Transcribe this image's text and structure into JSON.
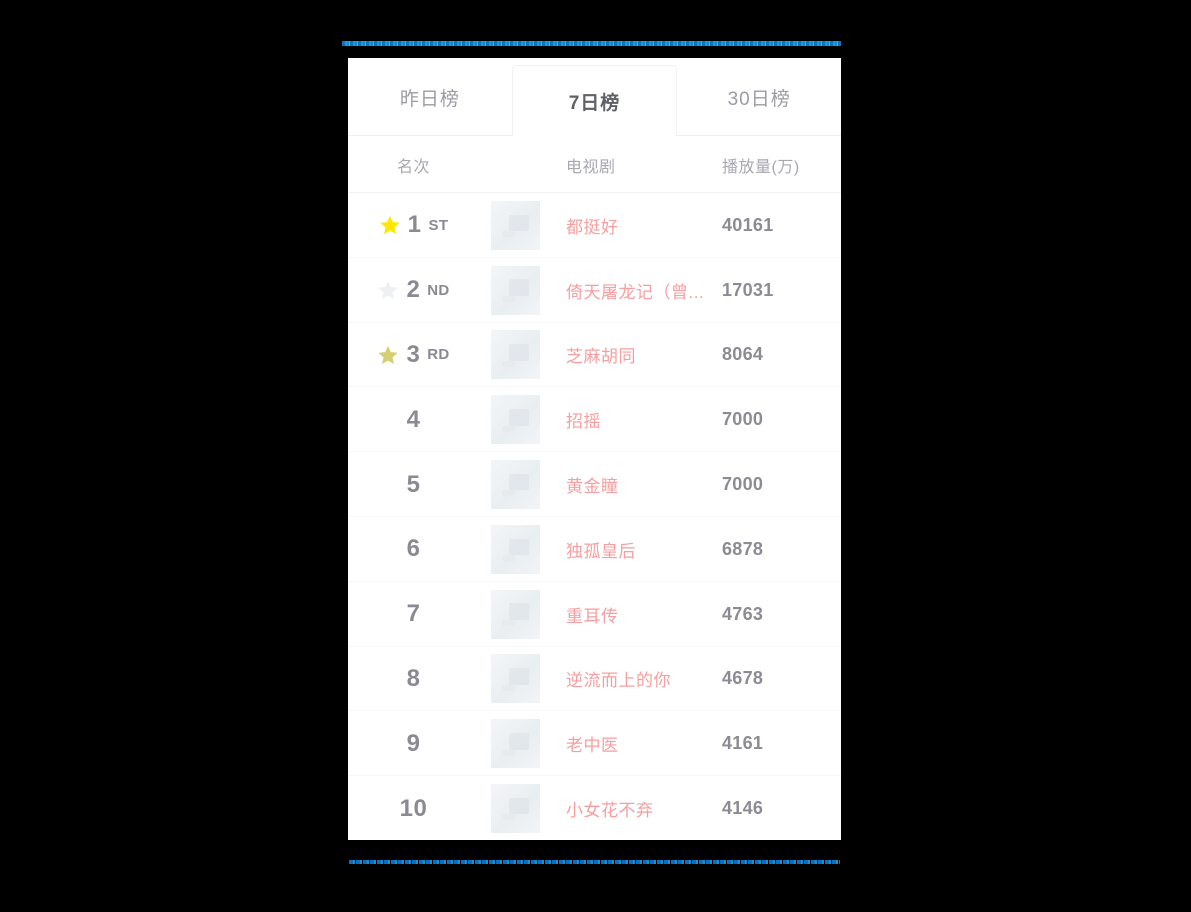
{
  "accent": {
    "top_bar_color": "#0b72c4",
    "bottom_bar_color": "#0a6fc0"
  },
  "tabs": [
    {
      "label": "昨日榜",
      "active": false
    },
    {
      "label": "7日榜",
      "active": true
    },
    {
      "label": "30日榜",
      "active": false
    }
  ],
  "columns": {
    "rank": "名次",
    "thumb": "",
    "title": "电视剧",
    "plays": "播放量(万)"
  },
  "colors": {
    "title_text": "#f79ea0",
    "plays_text": "#8b8b93",
    "rank_text": "#8a8a92",
    "header_text": "#a8a8b0",
    "gold_star": "#ffe800",
    "silver_star": "#eef0f2",
    "bronze_star": "#d6cf72"
  },
  "rows": [
    {
      "rank": "1",
      "suffix": "ST",
      "medal": "gold",
      "title": "都挺好",
      "plays": "40161"
    },
    {
      "rank": "2",
      "suffix": "ND",
      "medal": "silver",
      "title": "倚天屠龙记（曾...",
      "plays": "17031"
    },
    {
      "rank": "3",
      "suffix": "RD",
      "medal": "bronze",
      "title": "芝麻胡同",
      "plays": "8064"
    },
    {
      "rank": "4",
      "suffix": "",
      "medal": "none",
      "title": "招摇",
      "plays": "7000"
    },
    {
      "rank": "5",
      "suffix": "",
      "medal": "none",
      "title": "黄金瞳",
      "plays": "7000"
    },
    {
      "rank": "6",
      "suffix": "",
      "medal": "none",
      "title": "独孤皇后",
      "plays": "6878"
    },
    {
      "rank": "7",
      "suffix": "",
      "medal": "none",
      "title": "重耳传",
      "plays": "4763"
    },
    {
      "rank": "8",
      "suffix": "",
      "medal": "none",
      "title": "逆流而上的你",
      "plays": "4678"
    },
    {
      "rank": "9",
      "suffix": "",
      "medal": "none",
      "title": "老中医",
      "plays": "4161"
    },
    {
      "rank": "10",
      "suffix": "",
      "medal": "none",
      "title": "小女花不弃",
      "plays": "4146"
    }
  ]
}
